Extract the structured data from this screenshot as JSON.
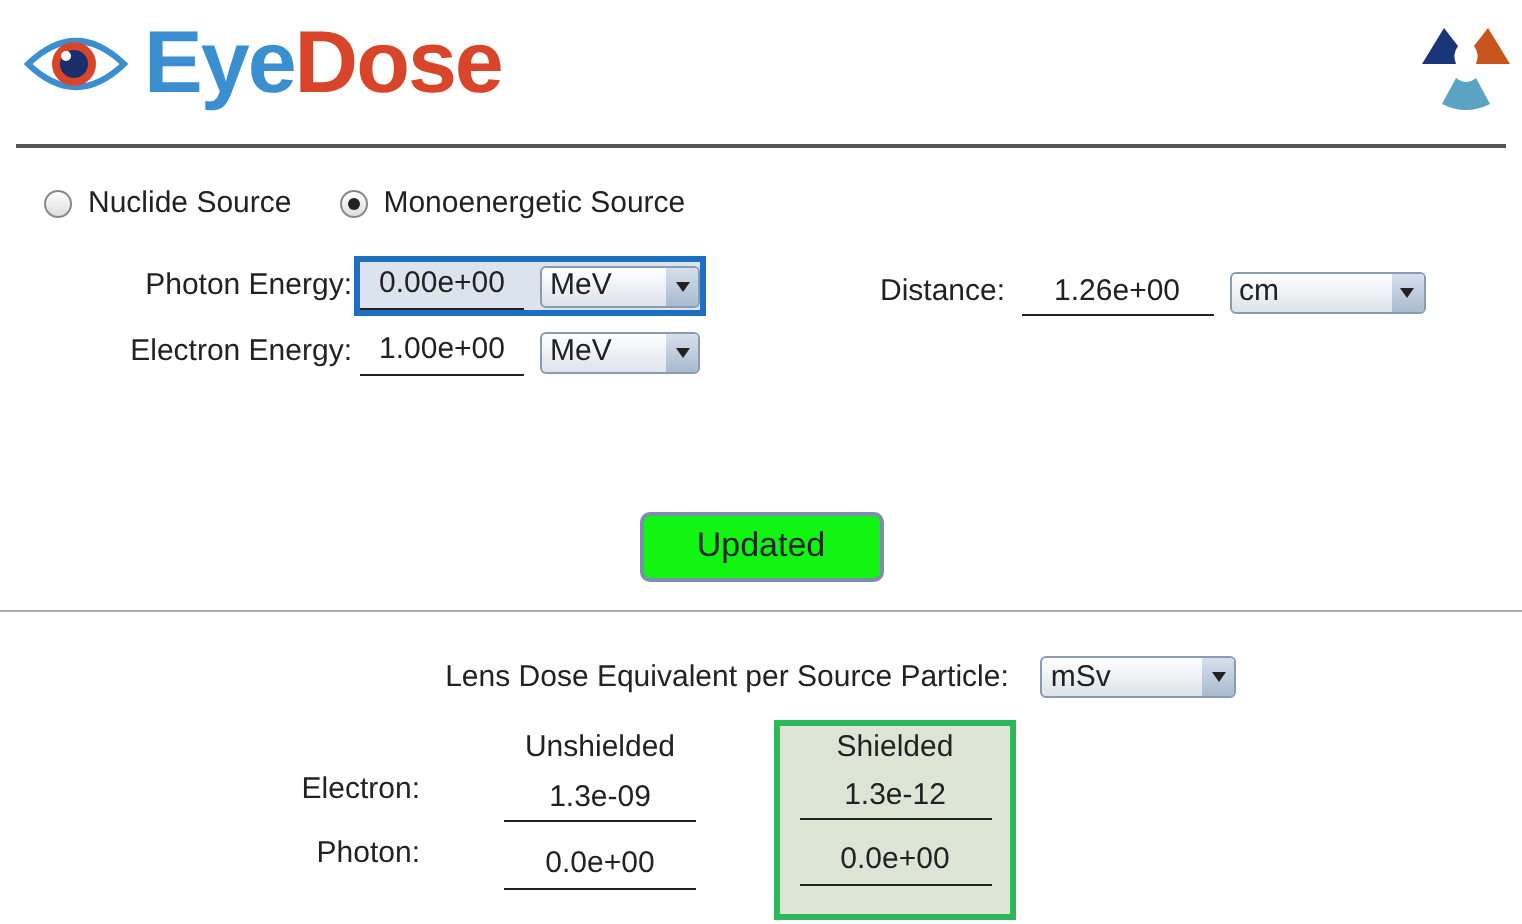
{
  "logo": {
    "parts": [
      {
        "text": "Eye",
        "color": "#3b8fd1"
      },
      {
        "text": "Dose",
        "color": "#d8452a"
      }
    ]
  },
  "source": [
    {
      "label": "Nuclide Source",
      "selected": false
    },
    {
      "label": "Monoenergetic Source",
      "selected": true
    }
  ],
  "energies": [
    {
      "label": "Photon Energy:",
      "value": "0.00e+00",
      "unit": "MeV",
      "focused": true
    },
    {
      "label": "Electron Energy:",
      "value": "1.00e+00",
      "unit": "MeV",
      "focused": false
    }
  ],
  "distance": {
    "label": "Distance:",
    "value": "1.26e+00",
    "unit": "cm"
  },
  "update_button": {
    "label": "Updated",
    "updated": true
  },
  "dose_unit": {
    "label": "Lens Dose Equivalent per Source Particle:",
    "unit": "mSv"
  },
  "results": {
    "columns": [
      "Unshielded",
      "Shielded"
    ],
    "rows": [
      {
        "label": "Electron:",
        "values": [
          "1.3e-09",
          "1.3e-12"
        ]
      },
      {
        "label": "Photon:",
        "values": [
          "0.0e+00",
          "0.0e+00"
        ]
      }
    ]
  }
}
